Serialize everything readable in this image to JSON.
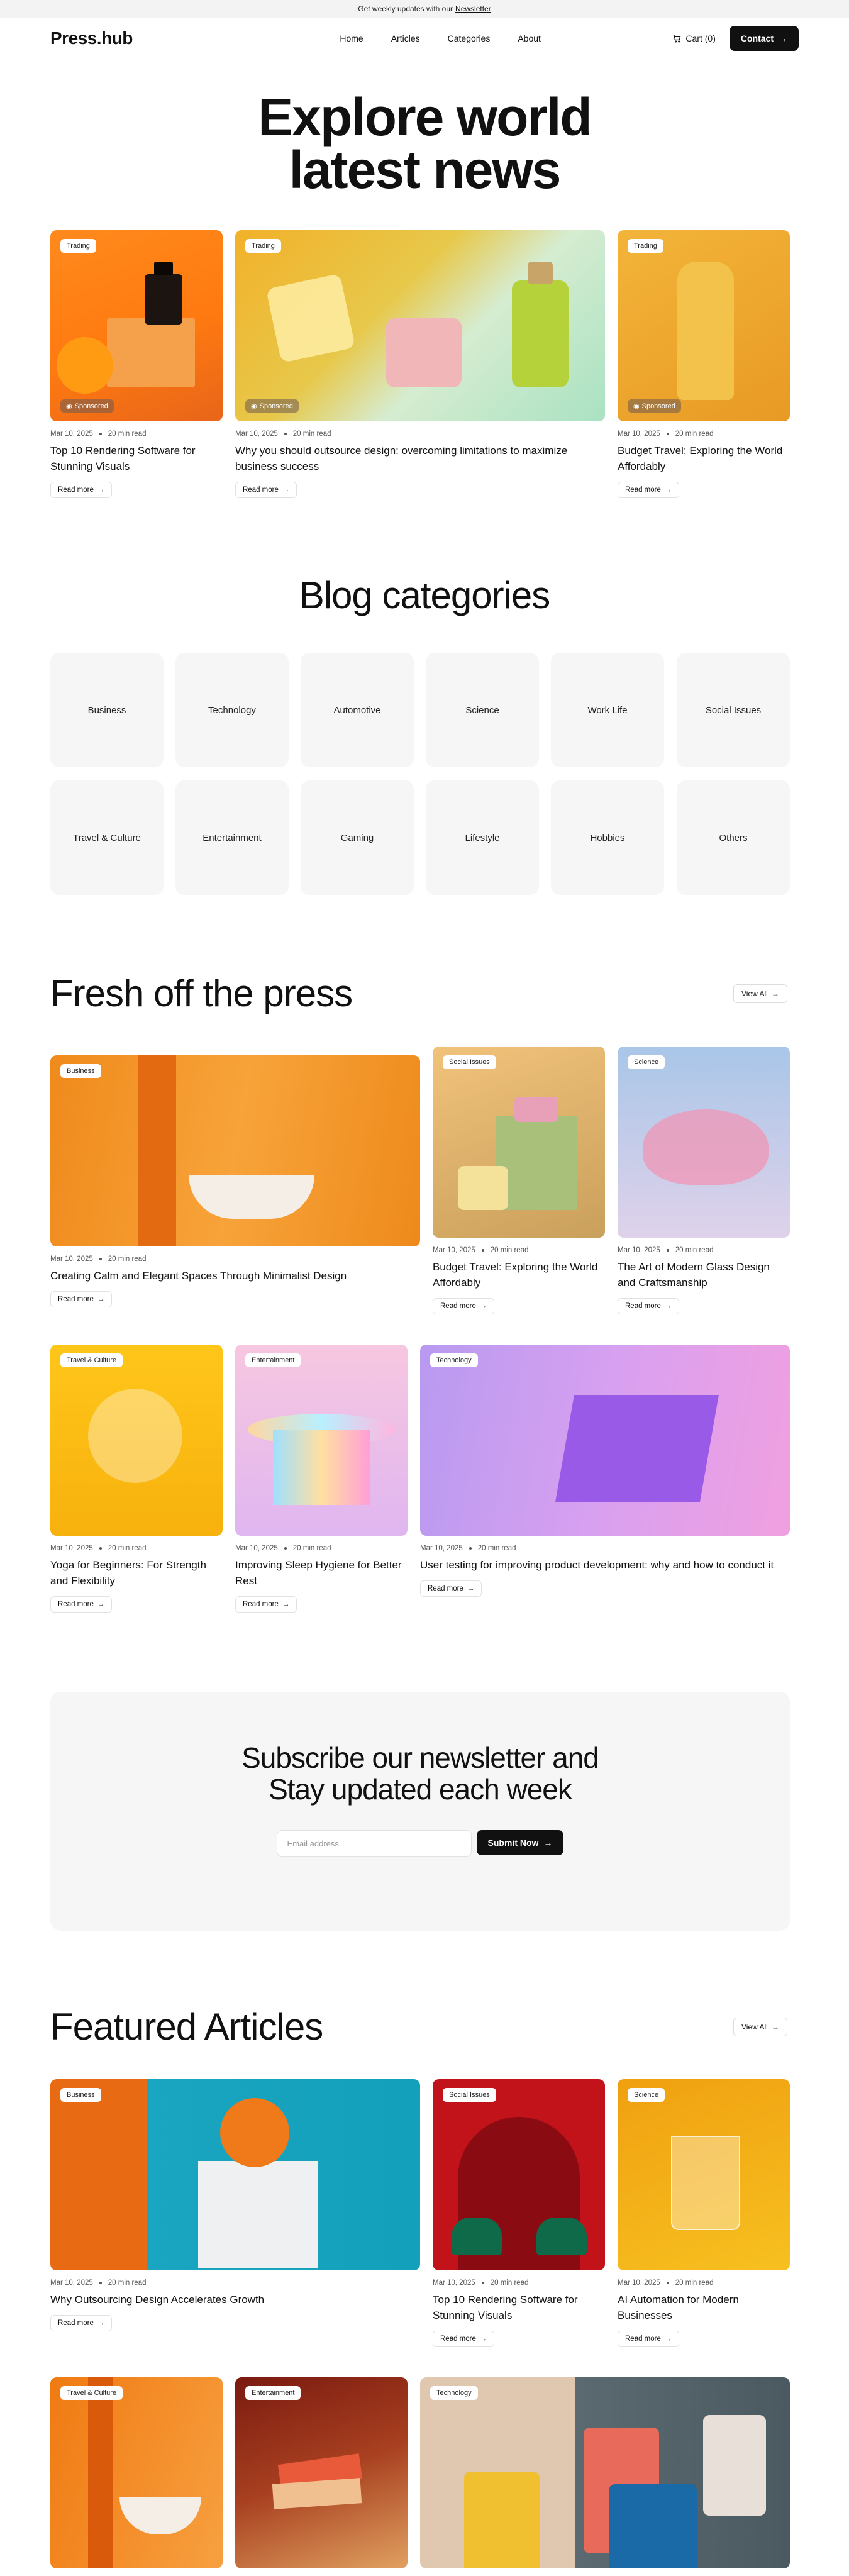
{
  "topbar": {
    "text": "Get weekly updates with our",
    "link": "Newsletter"
  },
  "nav": {
    "logo": "Press.hub",
    "links": [
      "Home",
      "Articles",
      "Categories",
      "About"
    ],
    "cart": "Cart (0)",
    "contact": "Contact"
  },
  "hero": {
    "line1": "Explore world",
    "line2": "latest news"
  },
  "top_cards": [
    {
      "tag": "Trading",
      "sponsored": "Sponsored",
      "date": "Mar 10, 2025",
      "read": "20 min read",
      "title": "Top 10 Rendering Software for Stunning Visuals",
      "cta": "Read more"
    },
    {
      "tag": "Trading",
      "sponsored": "Sponsored",
      "date": "Mar 10, 2025",
      "read": "20 min read",
      "title": "Why you should outsource design: overcoming limitations to maximize business success",
      "cta": "Read more"
    },
    {
      "tag": "Trading",
      "sponsored": "Sponsored",
      "date": "Mar 10, 2025",
      "read": "20 min read",
      "title": "Budget Travel: Exploring the World Affordably",
      "cta": "Read more"
    }
  ],
  "categories": {
    "title": "Blog categories",
    "items": [
      "Business",
      "Technology",
      "Automotive",
      "Science",
      "Work Life",
      "Social Issues",
      "Travel & Culture",
      "Entertainment",
      "Gaming",
      "Lifestyle",
      "Hobbies",
      "Others"
    ]
  },
  "fresh": {
    "title": "Fresh off the press",
    "view_all": "View All",
    "cards": [
      {
        "tag": "Business",
        "date": "Mar 10, 2025",
        "read": "20 min read",
        "title": "Creating Calm and Elegant Spaces Through Minimalist Design",
        "cta": "Read more"
      },
      {
        "tag": "Social Issues",
        "date": "Mar 10, 2025",
        "read": "20 min read",
        "title": "Budget Travel: Exploring the World Affordably",
        "cta": "Read more"
      },
      {
        "tag": "Science",
        "date": "Mar 10, 2025",
        "read": "20 min read",
        "title": "The Art of Modern Glass Design and Craftsmanship",
        "cta": "Read more"
      },
      {
        "tag": "Travel & Culture",
        "date": "Mar 10, 2025",
        "read": "20 min read",
        "title": "Yoga for Beginners: For Strength and Flexibility",
        "cta": "Read more"
      },
      {
        "tag": "Entertainment",
        "date": "Mar 10, 2025",
        "read": "20 min read",
        "title": "Improving Sleep Hygiene for Better Rest",
        "cta": "Read more"
      },
      {
        "tag": "Technology",
        "date": "Mar 10, 2025",
        "read": "20 min read",
        "title": "User testing for improving product development:  why and how to conduct it",
        "cta": "Read more"
      }
    ]
  },
  "newsletter": {
    "line1": "Subscribe our newsletter and",
    "line2": "Stay updated each week",
    "placeholder": "Email address",
    "submit": "Submit Now"
  },
  "featured": {
    "title": "Featured Articles",
    "view_all": "View All",
    "cards": [
      {
        "tag": "Business",
        "date": "Mar 10, 2025",
        "read": "20 min read",
        "title": "Why Outsourcing Design Accelerates Growth",
        "cta": "Read more"
      },
      {
        "tag": "Social Issues",
        "date": "Mar 10, 2025",
        "read": "20 min read",
        "title": "Top 10 Rendering Software for Stunning Visuals",
        "cta": "Read more"
      },
      {
        "tag": "Science",
        "date": "Mar 10, 2025",
        "read": "20 min read",
        "title": "AI Automation for Modern Businesses",
        "cta": "Read more"
      },
      {
        "tag": "Travel & Culture"
      },
      {
        "tag": "Entertainment"
      },
      {
        "tag": "Technology"
      }
    ]
  }
}
